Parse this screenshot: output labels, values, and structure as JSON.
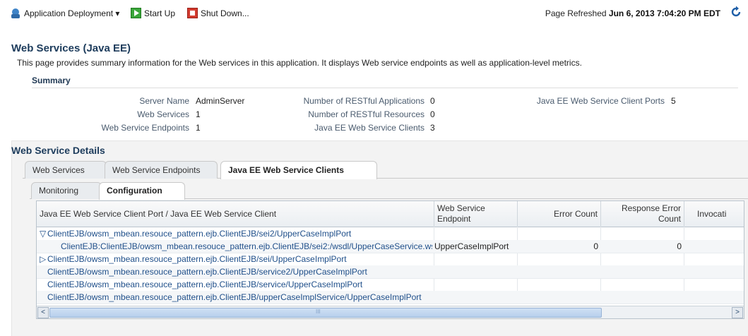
{
  "toolbar": {
    "deployment_menu": "Application Deployment ▾",
    "start_up": "Start Up",
    "shut_down": "Shut Down...",
    "refreshed_label": "Page Refreshed",
    "refreshed_value": "Jun 6, 2013 7:04:20 PM EDT"
  },
  "page": {
    "title": "Web Services (Java EE)",
    "description": "This page provides summary information for the Web services in this application. It displays Web service endpoints as well as application-level metrics."
  },
  "summary": {
    "heading": "Summary",
    "col1": [
      {
        "label": "Server Name",
        "value": "AdminServer"
      },
      {
        "label": "Web Services",
        "value": "1"
      },
      {
        "label": "Web Service Endpoints",
        "value": "1"
      }
    ],
    "col2": [
      {
        "label": "Number of RESTful Applications",
        "value": "0"
      },
      {
        "label": "Number of RESTful Resources",
        "value": "0"
      },
      {
        "label": "Java EE Web Service Clients",
        "value": "3"
      }
    ],
    "col3": [
      {
        "label": "Java EE Web Service Client Ports",
        "value": "5"
      }
    ]
  },
  "details": {
    "heading": "Web Service Details",
    "tabs": [
      "Web Services",
      "Web Service Endpoints",
      "Java EE Web Service Clients"
    ],
    "selected_tab": "Java EE Web Service Clients",
    "subtabs": [
      "Monitoring",
      "Configuration"
    ],
    "selected_subtab": "Configuration"
  },
  "table": {
    "headers": {
      "port": "Java EE Web Service Client Port / Java EE Web Service Client",
      "endpoint_1": "Web Service",
      "endpoint_2": "Endpoint",
      "error_count": "Error Count",
      "response_error_1": "Response Error",
      "response_error_2": "Count",
      "invocations": "Invocati"
    },
    "rows": [
      {
        "expander": "▽",
        "name": "ClientEJB/owsm_mbean.resouce_pattern.ejb.ClientEJB/sei2/UpperCaseImplPort",
        "endpoint": "",
        "error": "",
        "resp": ""
      },
      {
        "expander": "",
        "name": "ClientEJB:ClientEJB/owsm_mbean.resouce_pattern.ejb.ClientEJB/sei2:/wsdl/UpperCaseService.ws",
        "endpoint": "UpperCaseImplPort",
        "error": "0",
        "resp": "0"
      },
      {
        "expander": "▷",
        "name": "ClientEJB/owsm_mbean.resouce_pattern.ejb.ClientEJB/sei/UpperCaseImplPort",
        "endpoint": "",
        "error": "",
        "resp": ""
      },
      {
        "expander": "",
        "name": "ClientEJB/owsm_mbean.resouce_pattern.ejb.ClientEJB/service2/UpperCaseImplPort",
        "endpoint": "",
        "error": "",
        "resp": ""
      },
      {
        "expander": "",
        "name": "ClientEJB/owsm_mbean.resouce_pattern.ejb.ClientEJB/service/UpperCaseImplPort",
        "endpoint": "",
        "error": "",
        "resp": ""
      },
      {
        "expander": "",
        "name": "ClientEJB/owsm_mbean.resouce_pattern.ejb.ClientEJB/upperCaseImplService/UpperCaseImplPort",
        "endpoint": "",
        "error": "",
        "resp": ""
      }
    ],
    "scrollbar": {
      "left": "<",
      "right": ">",
      "grip": "III"
    }
  }
}
